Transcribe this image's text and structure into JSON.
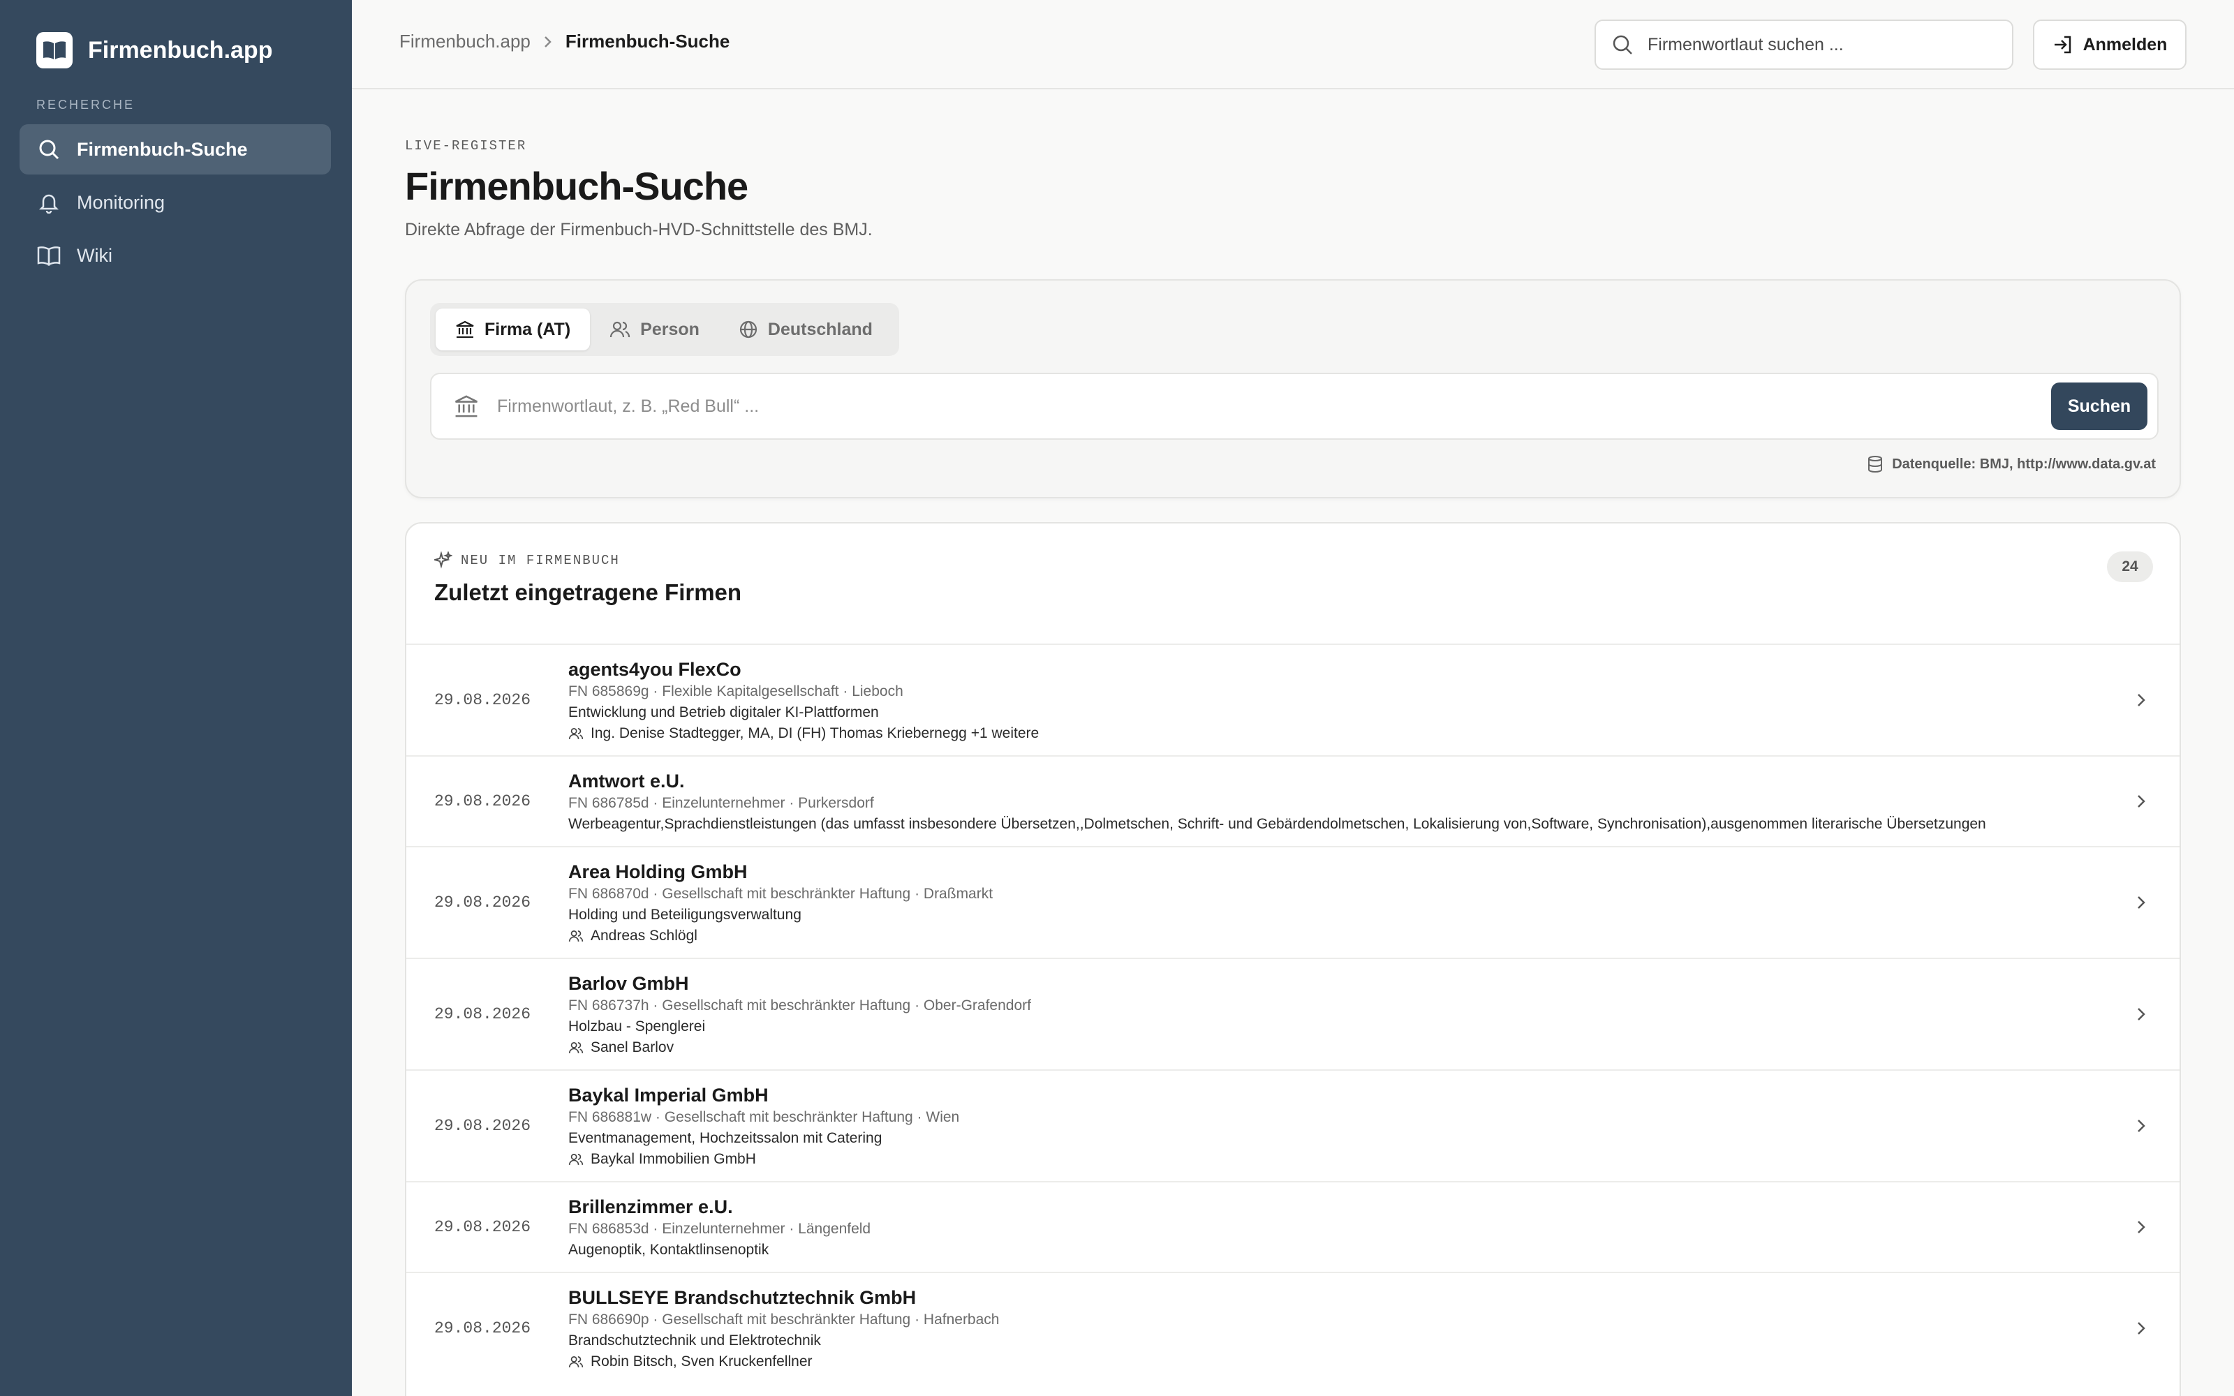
{
  "app": {
    "name": "Firmenbuch.app"
  },
  "sidebar": {
    "section": "RECHERCHE",
    "items": [
      {
        "label": "Firmenbuch-Suche",
        "icon": "search-icon",
        "active": true
      },
      {
        "label": "Monitoring",
        "icon": "bell-icon",
        "active": false
      },
      {
        "label": "Wiki",
        "icon": "book-icon",
        "active": false
      }
    ]
  },
  "header": {
    "breadcrumb": {
      "root": "Firmenbuch.app",
      "current": "Firmenbuch-Suche"
    },
    "search_placeholder": "Firmenwortlaut suchen ...",
    "login_label": "Anmelden"
  },
  "main": {
    "eyebrow": "LIVE-REGISTER",
    "title": "Firmenbuch-Suche",
    "subtitle": "Direkte Abfrage der Firmenbuch-HVD-Schnittstelle des BMJ.",
    "tabs": [
      {
        "label": "Firma (AT)",
        "icon": "bank-icon",
        "active": true
      },
      {
        "label": "Person",
        "icon": "people-icon",
        "active": false
      },
      {
        "label": "Deutschland",
        "icon": "globe-icon",
        "active": false
      }
    ],
    "query_placeholder": "Firmenwortlaut, z. B. „Red Bull“ ...",
    "search_button": "Suchen",
    "source": "Datenquelle: BMJ, http://www.data.gv.at"
  },
  "recent": {
    "eyebrow": "NEU IM FIRMENBUCH",
    "title": "Zuletzt eingetragene Firmen",
    "count": "24",
    "rows": [
      {
        "date": "29.08.2026",
        "name": "agents4you FlexCo",
        "meta": "FN 685869g · Flexible Kapitalgesellschaft · Lieboch",
        "desc": "Entwicklung und Betrieb digitaler KI-Plattformen",
        "people": "Ing. Denise Stadtegger, MA, DI (FH) Thomas Kriebernegg +1 weitere"
      },
      {
        "date": "29.08.2026",
        "name": "Amtwort e.U.",
        "meta": "FN 686785d · Einzelunternehmer · Purkersdorf",
        "desc": "Werbeagentur,Sprachdienstleistungen (das umfasst insbesondere Übersetzen,,Dolmetschen, Schrift- und Gebärdendolmetschen, Lokalisierung von,Software, Synchronisation),ausgenommen literarische Übersetzungen",
        "people": ""
      },
      {
        "date": "29.08.2026",
        "name": "Area Holding GmbH",
        "meta": "FN 686870d · Gesellschaft mit beschränkter Haftung · Draßmarkt",
        "desc": "Holding und Beteiligungsverwaltung",
        "people": "Andreas Schlögl"
      },
      {
        "date": "29.08.2026",
        "name": "Barlov GmbH",
        "meta": "FN 686737h · Gesellschaft mit beschränkter Haftung · Ober-Grafendorf",
        "desc": "Holzbau - Spenglerei",
        "people": "Sanel Barlov"
      },
      {
        "date": "29.08.2026",
        "name": "Baykal Imperial GmbH",
        "meta": "FN 686881w · Gesellschaft mit beschränkter Haftung · Wien",
        "desc": "Eventmanagement, Hochzeitssalon mit Catering",
        "people": "Baykal Immobilien GmbH"
      },
      {
        "date": "29.08.2026",
        "name": "Brillenzimmer e.U.",
        "meta": "FN 686853d · Einzelunternehmer · Längenfeld",
        "desc": "Augenoptik, Kontaktlinsenoptik",
        "people": ""
      },
      {
        "date": "29.08.2026",
        "name": "BULLSEYE Brandschutztechnik GmbH",
        "meta": "FN 686690p · Gesellschaft mit beschränkter Haftung · Hafnerbach",
        "desc": "Brandschutztechnik und Elektrotechnik",
        "people": "Robin Bitsch, Sven Kruckenfellner"
      }
    ]
  },
  "colors": {
    "sidebar": "#35495e",
    "accent": "#33475c",
    "background": "#f9f9f8"
  }
}
